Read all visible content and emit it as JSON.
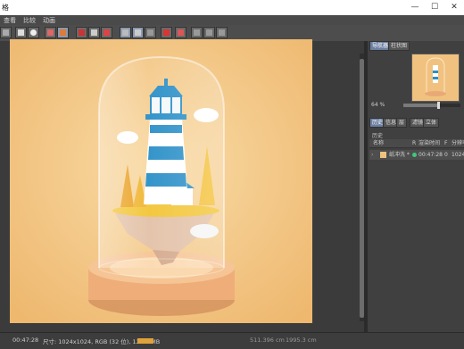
{
  "window": {
    "title": "格"
  },
  "menu": [
    "查看",
    "比较",
    "动画"
  ],
  "panel": {
    "tabs": [
      "导航器",
      "柱状图"
    ],
    "zoom": "64 %",
    "subtabs": [
      "历史",
      "信息",
      "层",
      "滤镜",
      "立体"
    ],
    "history_label": "历史",
    "columns": [
      "名称",
      "R",
      "渲染时间",
      "F",
      "分辨率"
    ],
    "row": {
      "name": "纸冲洗 *",
      "time": "00:47:28",
      "frame": "0",
      "resolution": "1024"
    }
  },
  "status": {
    "time": "00:47:28",
    "info": "尺寸: 1024x1024, RGB (32 位), 12.03 MB",
    "mem": "511.396 cm",
    "mem2": "1995.3 cm"
  },
  "colors": {
    "accent": "#6b7fa0",
    "background": "#3a3a3a",
    "render_bg": "#f3c98a"
  }
}
